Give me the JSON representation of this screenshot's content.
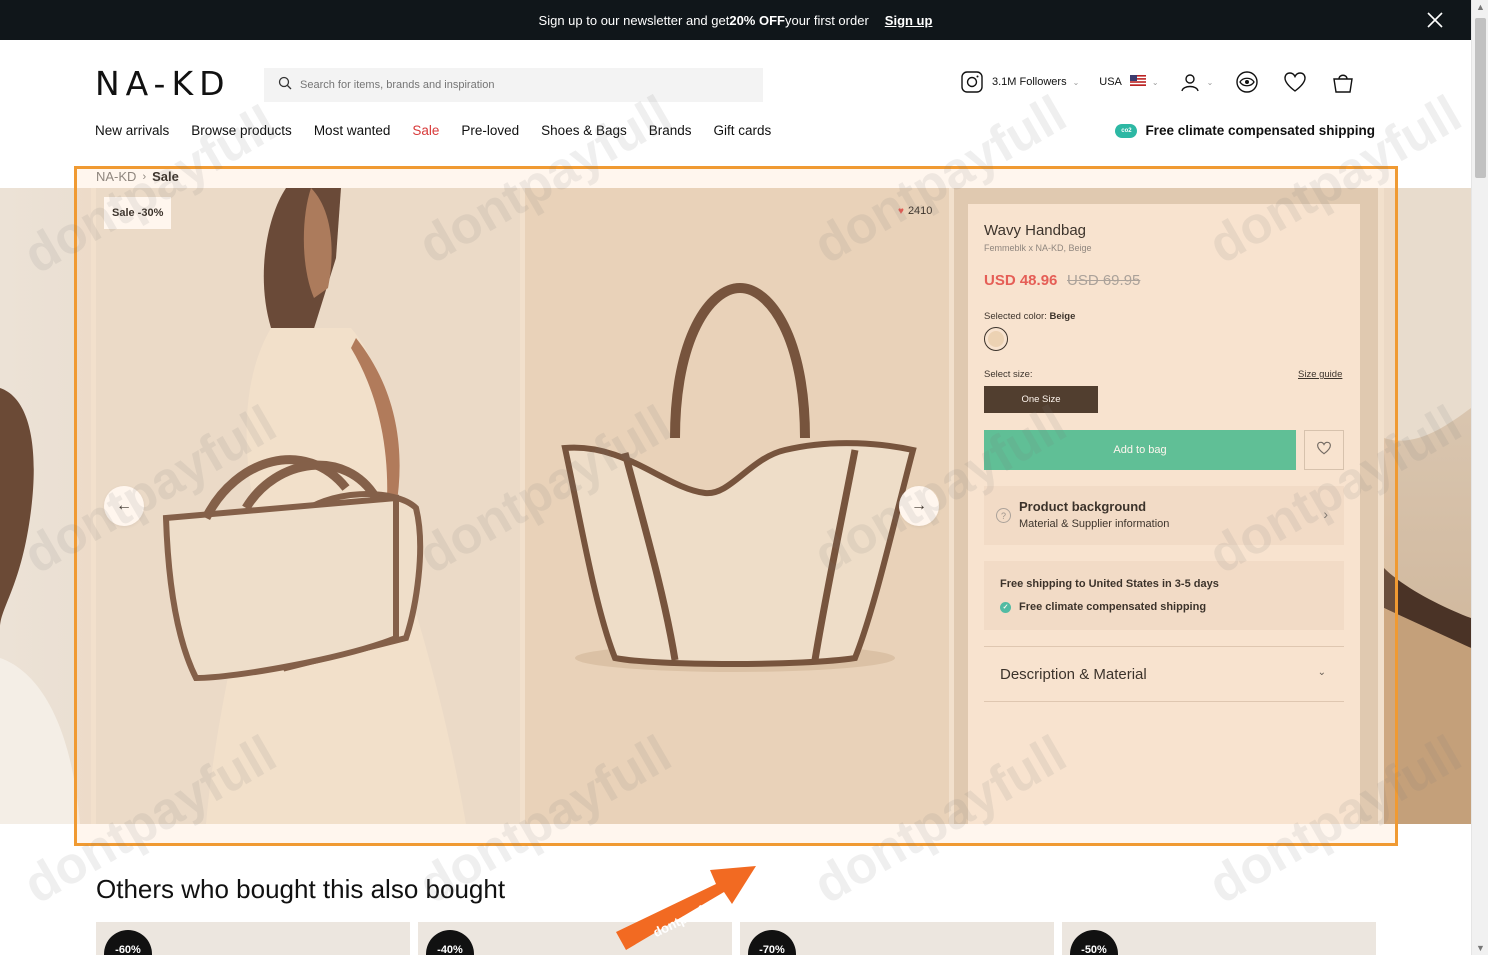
{
  "banner": {
    "text_pre": "Sign up to our newsletter and get ",
    "text_bold": "20% OFF",
    "text_post": " your first order",
    "signup_label": "Sign up"
  },
  "header": {
    "logo": "NA-KD",
    "search_placeholder": "Search for items, brands and inspiration",
    "followers": "3.1M Followers",
    "country": "USA"
  },
  "nav": {
    "items": [
      {
        "label": "New arrivals"
      },
      {
        "label": "Browse products"
      },
      {
        "label": "Most wanted"
      },
      {
        "label": "Sale"
      },
      {
        "label": "Pre-loved"
      },
      {
        "label": "Shoes & Bags"
      },
      {
        "label": "Brands"
      },
      {
        "label": "Gift cards"
      }
    ],
    "climate_label": "Free climate compensated shipping",
    "co2_label": "co2"
  },
  "breadcrumb": {
    "home": "NA-KD",
    "current": "Sale"
  },
  "gallery": {
    "sale_tag": "Sale -30%",
    "likes": "2410"
  },
  "product": {
    "title": "Wavy Handbag",
    "subtitle": "Femmeblk x NA-KD, Beige",
    "price": "USD 48.96",
    "old_price": "USD 69.95",
    "color_label": "Selected color:",
    "color_value": "Beige",
    "size_label": "Select size:",
    "size_guide": "Size guide",
    "size_option": "One Size",
    "add_to_bag": "Add to bag",
    "background_title": "Product background",
    "background_sub": "Material & Supplier information",
    "shipping_line1": "Free shipping to United States in 3-5 days",
    "shipping_line2": "Free climate compensated shipping",
    "description_label": "Description & Material"
  },
  "others": {
    "heading": "Others who bought this also bought",
    "items": [
      {
        "badge": "-60%"
      },
      {
        "badge": "-40%"
      },
      {
        "badge": "-70%"
      },
      {
        "badge": "-50%"
      }
    ]
  },
  "watermark": "dontpayfull",
  "promo_label": "dontpayfull",
  "colors": {
    "banner_bg": "#10161a",
    "sale_red": "#d83a3a",
    "price_red": "#e04646",
    "add_green": "#3ebc94",
    "climate_teal": "#2db8a4",
    "highlight": "#f09a32"
  }
}
